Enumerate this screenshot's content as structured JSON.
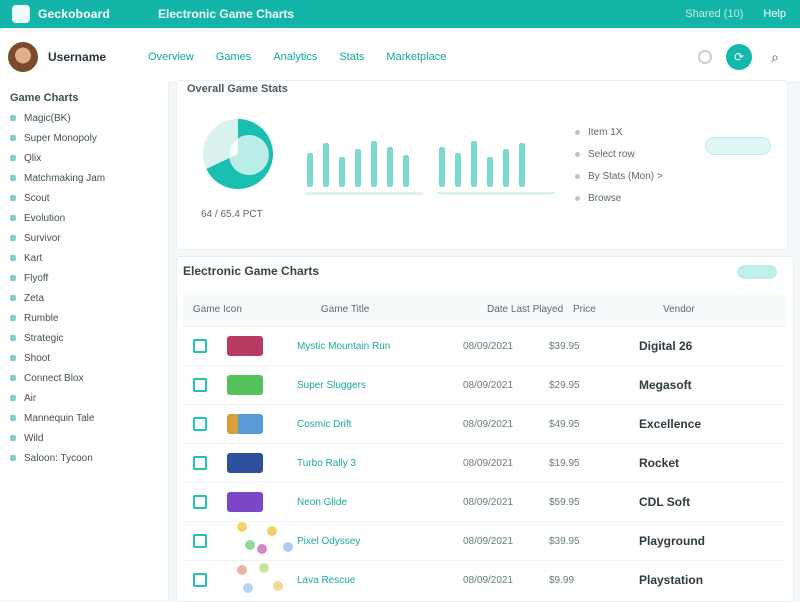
{
  "app": {
    "brand": "Geckoboard",
    "window_title": "Electronic Game Charts"
  },
  "topbar": {
    "right_links": [
      "Shared (10)",
      "Help"
    ]
  },
  "user": {
    "name": "Username"
  },
  "nav": {
    "items": [
      "Overview",
      "Games",
      "Analytics",
      "Stats",
      "Marketplace"
    ]
  },
  "sidebar": {
    "title": "Game Charts",
    "items": [
      "Magic(BK)",
      "Super Monopoly",
      "Qlix",
      "Matchmaking Jam",
      "Scout",
      "Evolution",
      "Survivor",
      "Kart",
      "Flyoff",
      "Zeta",
      "Rumble",
      "Strategic",
      "Shoot",
      "Connect Blox",
      "Air",
      "Mannequin Tale",
      "Wild",
      "Saloon: Tycoon"
    ]
  },
  "overview": {
    "title": "Overall Game Stats",
    "donut_label": "64 / 65.4  PCT",
    "legend": [
      "Item 1X",
      "Select row",
      "By Stats (Mon) >",
      "Browse"
    ]
  },
  "table": {
    "title": "Electronic Game Charts",
    "columns": [
      "Game Icon",
      "Game Title",
      "Date Last Played",
      "Price",
      "Vendor"
    ],
    "rows": [
      {
        "title": "Mystic Mountain Run",
        "date": "08/09/2021",
        "price": "$39.95",
        "vendor": "Digital 26",
        "thumb": "#b83b62"
      },
      {
        "title": "Super Sluggers",
        "date": "08/09/2021",
        "price": "$29.95",
        "vendor": "Megasoft",
        "thumb": "#55c15a"
      },
      {
        "title": "Cosmic Drift",
        "date": "08/09/2021",
        "price": "$49.95",
        "vendor": "Excellence",
        "thumb": "#5b9ad6"
      },
      {
        "title": "Turbo Rally 3",
        "date": "08/09/2021",
        "price": "$19.95",
        "vendor": "Rocket",
        "thumb": "#2e4f99"
      },
      {
        "title": "Neon Glide",
        "date": "08/09/2021",
        "price": "$59.95",
        "vendor": "CDL Soft",
        "thumb": "#7b47c6"
      },
      {
        "title": "Pixel Odyssey",
        "date": "08/09/2021",
        "price": "$39.95",
        "vendor": "Playground",
        "thumb": "scatter"
      },
      {
        "title": "Lava Rescue",
        "date": "08/09/2021",
        "price": "$9.99",
        "vendor": "Playstation",
        "thumb": "scatter"
      }
    ]
  },
  "colors": {
    "accent": "#12b5a8",
    "bg": "#f4f8fa"
  }
}
